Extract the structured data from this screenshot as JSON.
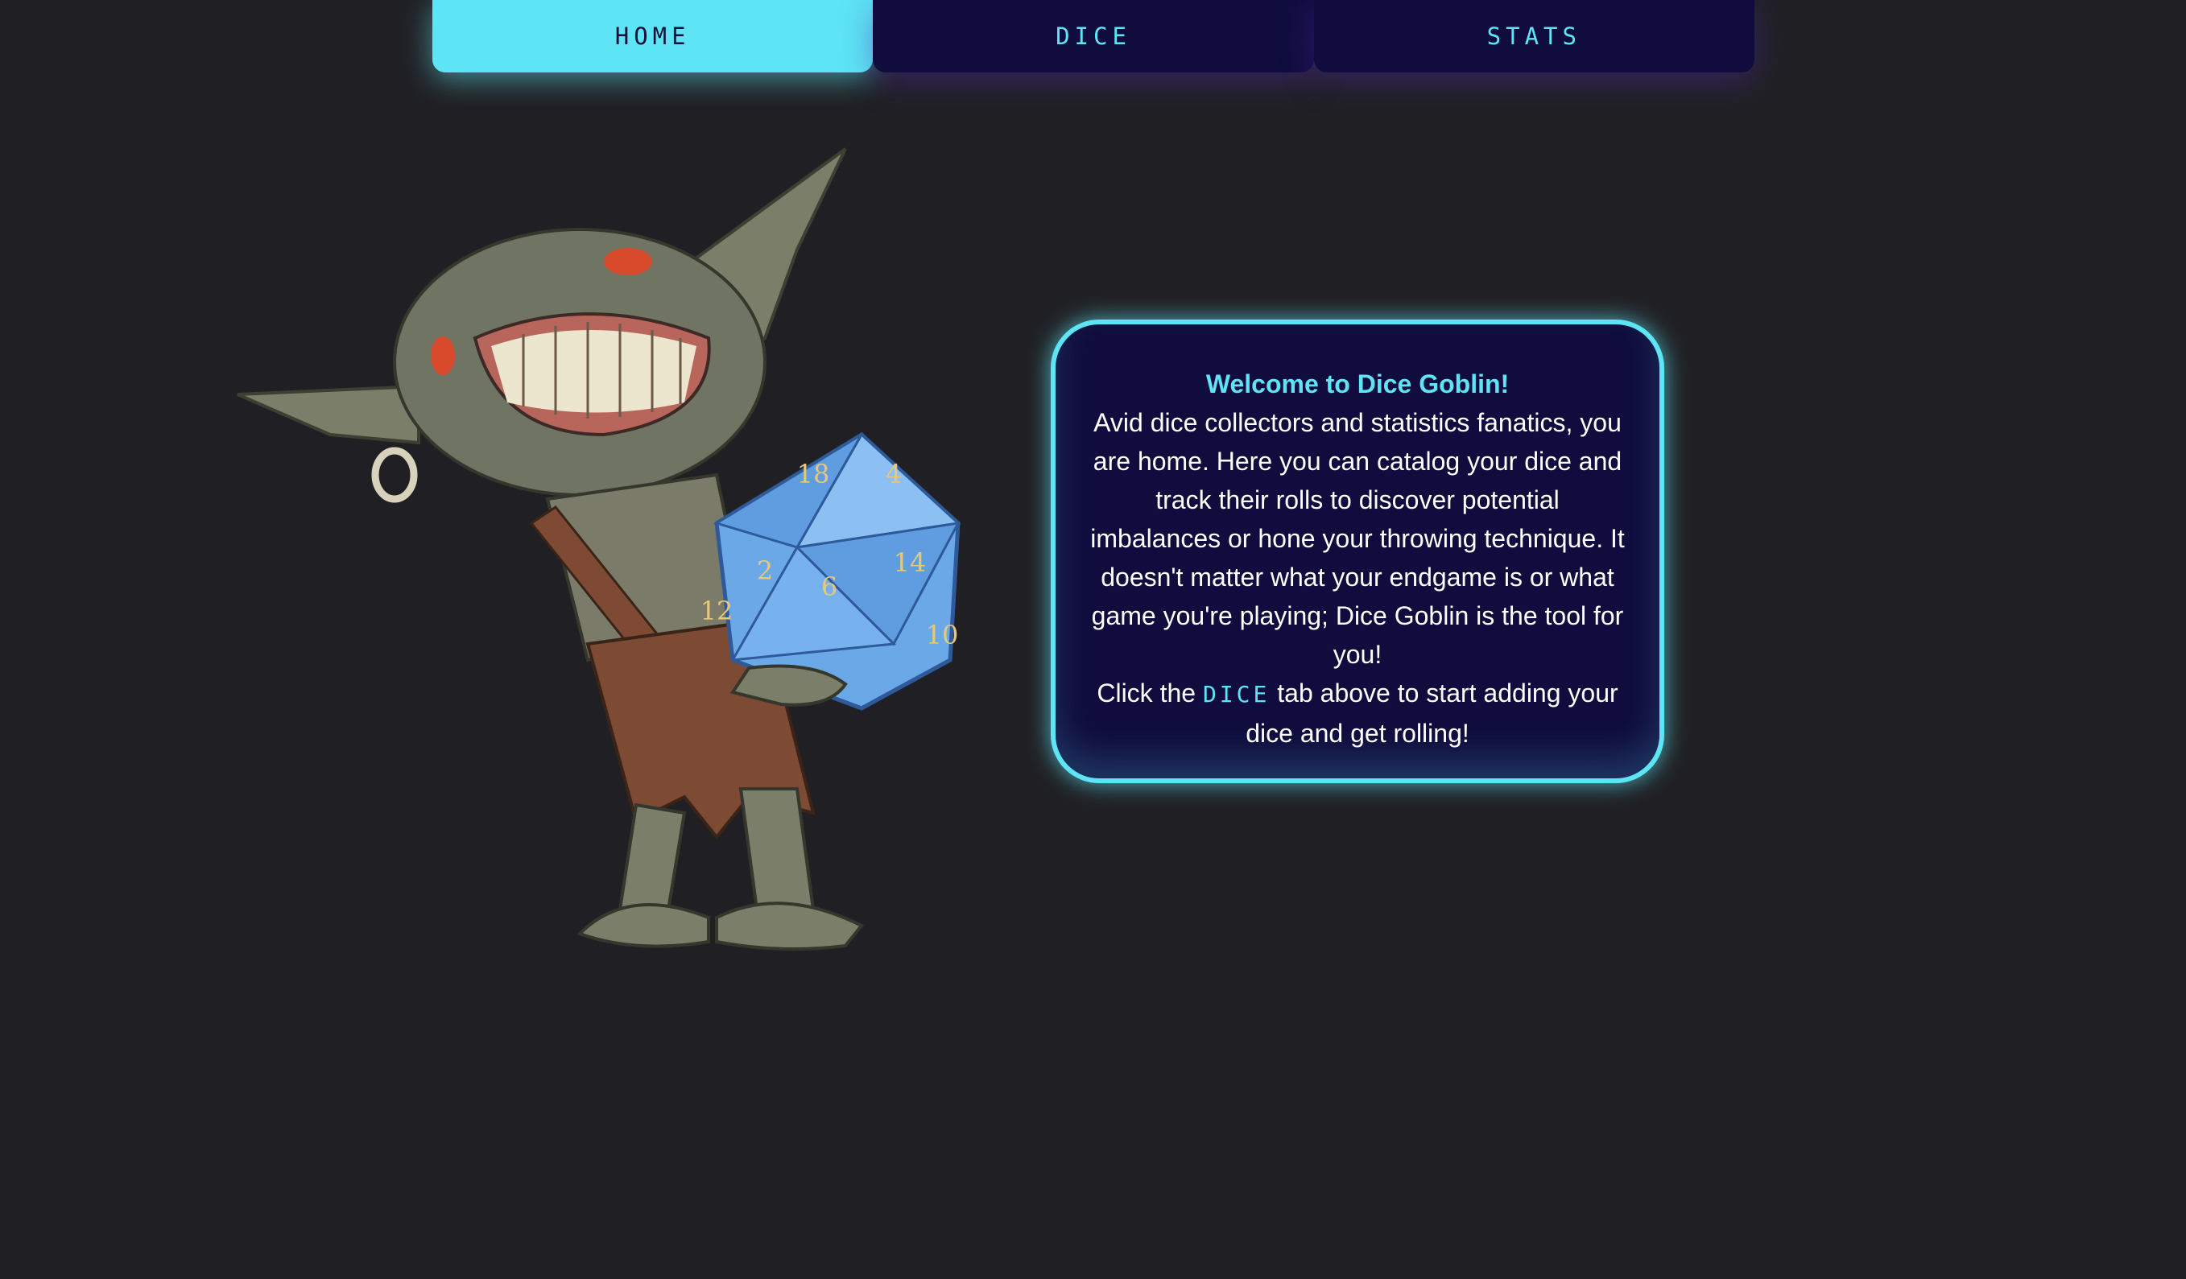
{
  "nav": {
    "tabs": [
      {
        "label": "HOME",
        "active": true
      },
      {
        "label": "DICE",
        "active": false
      },
      {
        "label": "STATS",
        "active": false
      }
    ]
  },
  "welcome": {
    "title": "Welcome to Dice Goblin!",
    "body": "Avid dice collectors and statistics fanatics, you are home. Here you can catalog your dice and track their rolls to discover potential imbalances or hone your throwing technique. It doesn't matter what your endgame is or what game you're playing; Dice Goblin is the tool for you!",
    "cta_prefix": "Click the ",
    "cta_link": "DICE",
    "cta_suffix": " tab above to start adding your dice and get rolling!"
  },
  "hero": {
    "icon": "goblin-holding-d20-illustration",
    "die_numbers": [
      "18",
      "4",
      "2",
      "6",
      "14",
      "12",
      "10"
    ]
  },
  "colors": {
    "background": "#202024",
    "accent": "#5ee5f5",
    "panel": "#100d3e",
    "text": "#ffffff"
  }
}
